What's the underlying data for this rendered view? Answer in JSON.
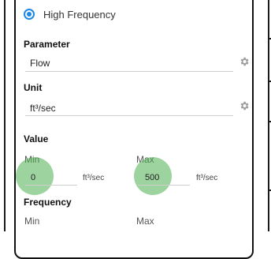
{
  "frequency_option": {
    "label": "High Frequency",
    "selected": true
  },
  "parameter": {
    "heading": "Parameter",
    "value": "Flow",
    "icon": "gear-icon"
  },
  "unit": {
    "heading": "Unit",
    "value": "ft³/sec",
    "icon": "gear-icon"
  },
  "value_section": {
    "heading": "Value",
    "min": {
      "label": "Min",
      "value": "0",
      "unit": "ft³/sec"
    },
    "max": {
      "label": "Max",
      "value": "500",
      "unit": "ft³/sec"
    }
  },
  "frequency_section": {
    "heading": "Frequency",
    "min_label": "Min",
    "max_label": "Max"
  },
  "colors": {
    "accent": "#1e88e5",
    "touch_indicator": "#4caf50"
  }
}
